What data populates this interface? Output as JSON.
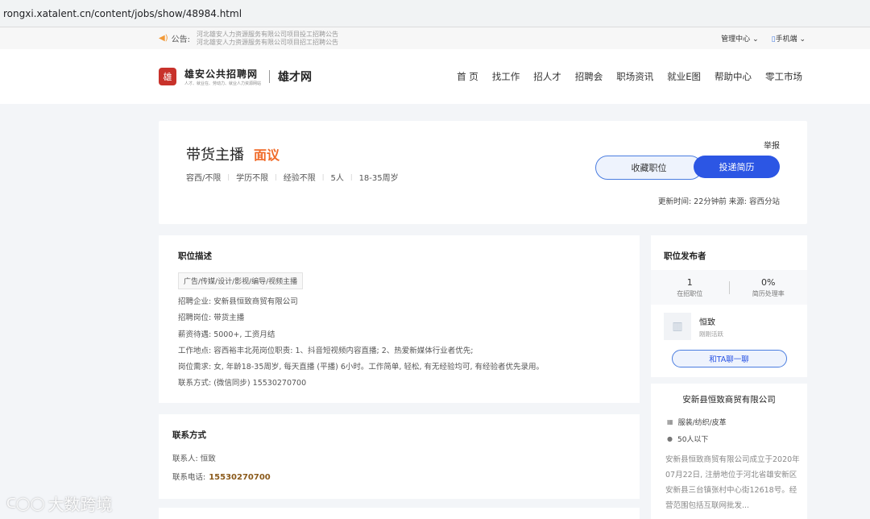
{
  "browser": {
    "url": "rongxi.xatalent.cn/content/jobs/show/48984.html"
  },
  "topbar": {
    "notice_label": "公告:",
    "ticker_1": "河北雄安人力资源服务有限公司项目投工招聘公告",
    "ticker_2": "河北雄安人力资源服务有限公司项目招工招聘公告",
    "admin_center": "管理中心",
    "mobile": "手机端"
  },
  "header": {
    "logo_mark": "雄",
    "logo_title": "雄安公共招聘网",
    "logo_sub": "人才、就业在、劳动力、就业人力资源网站",
    "logo_2": "雄才网",
    "nav": [
      "首 页",
      "找工作",
      "招人才",
      "招聘会",
      "职场资讯",
      "就业E图",
      "帮助中心",
      "零工市场"
    ]
  },
  "job": {
    "title": "带货主播",
    "salary": "面议",
    "meta": [
      "容西/不限",
      "学历不限",
      "经验不限",
      "5人",
      "18-35周岁"
    ],
    "report": "举报",
    "fav_button": "收藏职位",
    "apply_button": "投递简历",
    "update": "更新时间:  22分钟前    来源: 容西分站"
  },
  "description": {
    "heading": "职位描述",
    "tag": "广告/传媒/设计/影视/编导/视频主播",
    "lines": [
      "招聘企业: 安新县恒致商贸有限公司",
      "招聘岗位: 带货主播",
      "薪资待遇: 5000+, 工资月结",
      "工作地点: 容西裕丰北苑岗位职责: 1、抖音短视频内容直播; 2、热爱新媒体行业者优先;",
      "岗位需求: 女, 年龄18-35周岁, 每天直播 (平播) 6小时。工作简单, 轻松, 有无经验均可, 有经验者优先录用。",
      "联系方式: (微信同步) 15530270700"
    ]
  },
  "contact": {
    "heading": "联系方式",
    "person_label": "联系人:",
    "person": "恒致",
    "phone_label": "联系电话:",
    "phone": "15530270700"
  },
  "publisher": {
    "heading": "职位发布者",
    "stat_1_value": "1",
    "stat_1_label": "在招职位",
    "stat_2_value": "0%",
    "stat_2_label": "简历处理率",
    "name": "恒致",
    "status": "刚刚活跃",
    "chat_button": "和TA聊一聊",
    "company": "安新县恒致商贸有限公司",
    "industry": "服装/纺织/皮革",
    "size": "50人以下",
    "intro": "安新县恒致商贸有限公司成立于2020年07月22日, 注册地位于河北省雄安新区安新县三台镇张村中心街12618号。经营范围包括互联网批发..."
  },
  "watermark": "大数跨境"
}
